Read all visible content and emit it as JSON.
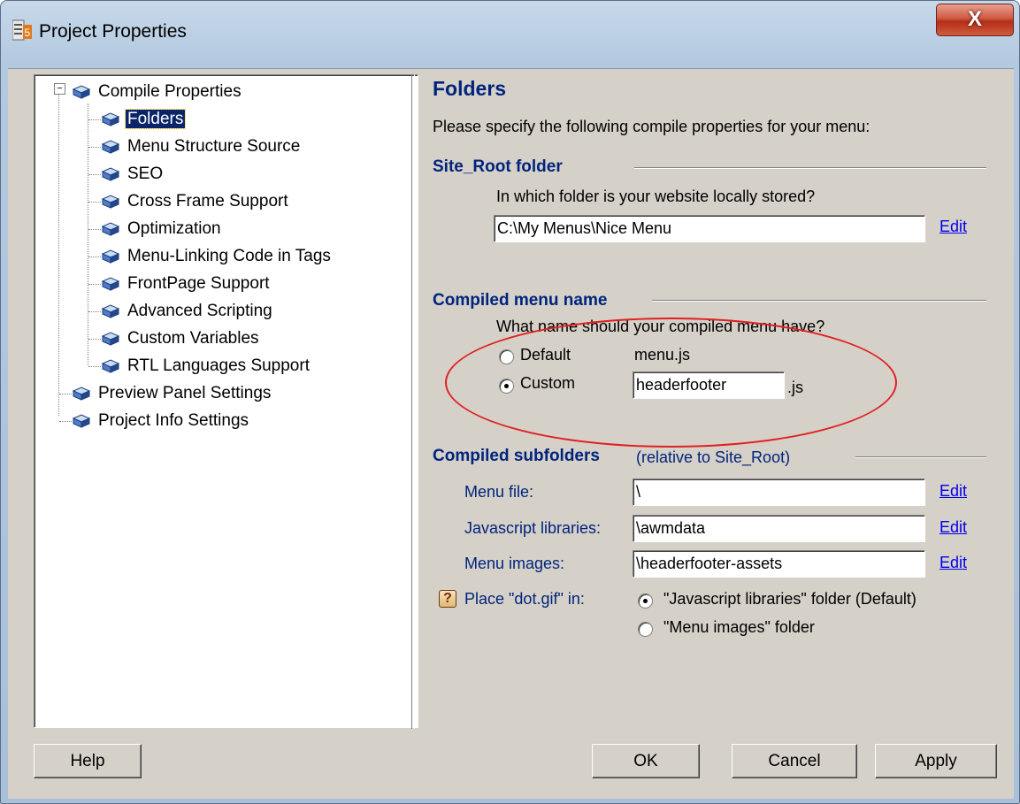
{
  "window": {
    "title": "Project Properties",
    "close_glyph": "X"
  },
  "tree": {
    "root_expander": "−",
    "items": [
      {
        "label": "Compile Properties",
        "icon": "node-icon"
      },
      {
        "label": "Folders",
        "icon": "node-icon",
        "selected": true
      },
      {
        "label": "Menu Structure Source",
        "icon": "node-icon"
      },
      {
        "label": "SEO",
        "icon": "node-icon"
      },
      {
        "label": "Cross Frame Support",
        "icon": "node-icon"
      },
      {
        "label": "Optimization",
        "icon": "node-icon"
      },
      {
        "label": "Menu-Linking Code in Tags",
        "icon": "node-icon"
      },
      {
        "label": "FrontPage Support",
        "icon": "node-icon"
      },
      {
        "label": "Advanced Scripting",
        "icon": "node-icon"
      },
      {
        "label": "Custom Variables",
        "icon": "node-icon"
      },
      {
        "label": "RTL Languages Support",
        "icon": "node-icon"
      },
      {
        "label": "Preview Panel Settings",
        "icon": "node-icon"
      },
      {
        "label": "Project Info Settings",
        "icon": "node-icon"
      }
    ]
  },
  "panel": {
    "title": "Folders",
    "intro": "Please specify the following compile properties for your menu:",
    "site_root": {
      "heading": "Site_Root folder",
      "question": "In which folder is your website locally stored?",
      "value": "C:\\My Menus\\Nice Menu",
      "edit_label": "Edit"
    },
    "compiled_name": {
      "heading": "Compiled menu name",
      "question": "What name should your compiled menu have?",
      "default_label": "Default",
      "default_value": "menu.js",
      "custom_label": "Custom",
      "custom_value": "headerfooter",
      "custom_suffix": ".js",
      "selected": "custom"
    },
    "subfolders": {
      "heading": "Compiled subfolders",
      "note": "(relative to Site_Root)",
      "rows": [
        {
          "label": "Menu file:",
          "value": "\\",
          "edit_label": "Edit"
        },
        {
          "label": "Javascript libraries:",
          "value": "\\awmdata",
          "edit_label": "Edit"
        },
        {
          "label": "Menu images:",
          "value": "\\headerfooter-assets",
          "edit_label": "Edit"
        }
      ],
      "dot_gif_label": "Place \"dot.gif\" in:",
      "help_glyph": "?",
      "dot_gif_options": [
        {
          "label": "\"Javascript libraries\" folder (Default)",
          "selected": true
        },
        {
          "label": "\"Menu images\" folder",
          "selected": false
        }
      ]
    }
  },
  "buttons": {
    "help": "Help",
    "ok": "OK",
    "cancel": "Cancel",
    "apply": "Apply"
  },
  "colors": {
    "heading": "#00247d",
    "selection": "#0a246a",
    "link": "#0000ee",
    "annotation": "#e02020"
  }
}
